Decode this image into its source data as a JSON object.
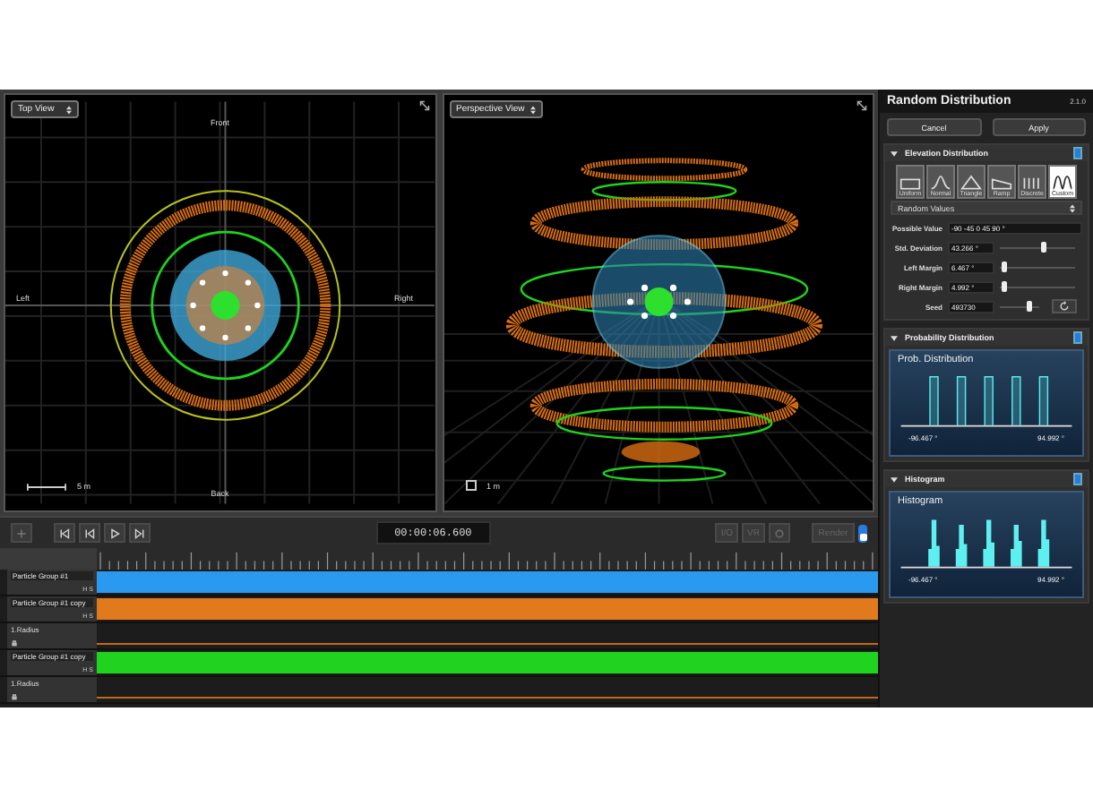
{
  "viewports": [
    {
      "title": "Top View",
      "kind": "top",
      "labels": [
        "Front",
        "Left",
        "Right",
        "Back"
      ],
      "scale": "5 m"
    },
    {
      "title": "Perspective View",
      "kind": "perspective",
      "scale": "1 m"
    }
  ],
  "transport": {
    "timecode": "00:00:06.600",
    "toggles": [
      "I/O",
      "VR"
    ],
    "render": "Render",
    "render_on": true
  },
  "tracks": [
    {
      "name": "Particle Group #1",
      "kind": "group",
      "color": "#2a9af0",
      "h": "H",
      "s": "S"
    },
    {
      "name": "Particle Group #1 copy",
      "kind": "group",
      "color": "#e07a1c",
      "h": "H",
      "s": "S"
    },
    {
      "name": "1.Radius",
      "kind": "param",
      "color": "#c06a18"
    },
    {
      "name": "Particle Group #1 copy",
      "kind": "group",
      "color": "#1fd31f",
      "h": "H",
      "s": "S"
    },
    {
      "name": "1.Radius",
      "kind": "param",
      "color": "#c06a18"
    }
  ],
  "panel": {
    "title": "Random Distribution",
    "version": "2.1.0",
    "buttons": [
      "Cancel",
      "Apply"
    ],
    "elevation": {
      "title": "Elevation Distribution",
      "expanded": true,
      "enabled": true,
      "types": [
        {
          "label": "Uniform",
          "kind": "uniform",
          "selected": false
        },
        {
          "label": "Normal",
          "kind": "normal",
          "selected": false
        },
        {
          "label": "Triangle",
          "kind": "triangle",
          "selected": false
        },
        {
          "label": "Ramp",
          "kind": "ramp",
          "selected": false
        },
        {
          "label": "Discrete",
          "kind": "discrete",
          "selected": false
        },
        {
          "label": "Custom",
          "kind": "custom",
          "selected": true
        }
      ],
      "mode": "Random Values",
      "rows": [
        {
          "label": "Possible Value",
          "value": "-90 -45 0 45 90 °",
          "kind": "text"
        },
        {
          "label": "Std. Deviation",
          "value": "43.266 °",
          "kind": "slider",
          "level": 0.6
        },
        {
          "label": "Left Margin",
          "value": "6.467 °",
          "kind": "slider",
          "level": 0.08
        },
        {
          "label": "Right Margin",
          "value": "4.992 °",
          "kind": "slider",
          "level": 0.08
        },
        {
          "label": "Seed",
          "value": "493730",
          "kind": "seed",
          "level": 0.75
        }
      ]
    },
    "probability": {
      "title": "Probability Distribution",
      "expanded": true,
      "enabled": true,
      "chart_title": "Prob. Distribution",
      "min": "-96.467 °",
      "max": "94.992 °"
    },
    "histogram": {
      "title": "Histogram",
      "expanded": true,
      "enabled": true,
      "chart_title": "Histogram",
      "min": "-96.467 °",
      "max": "94.992 °"
    }
  }
}
